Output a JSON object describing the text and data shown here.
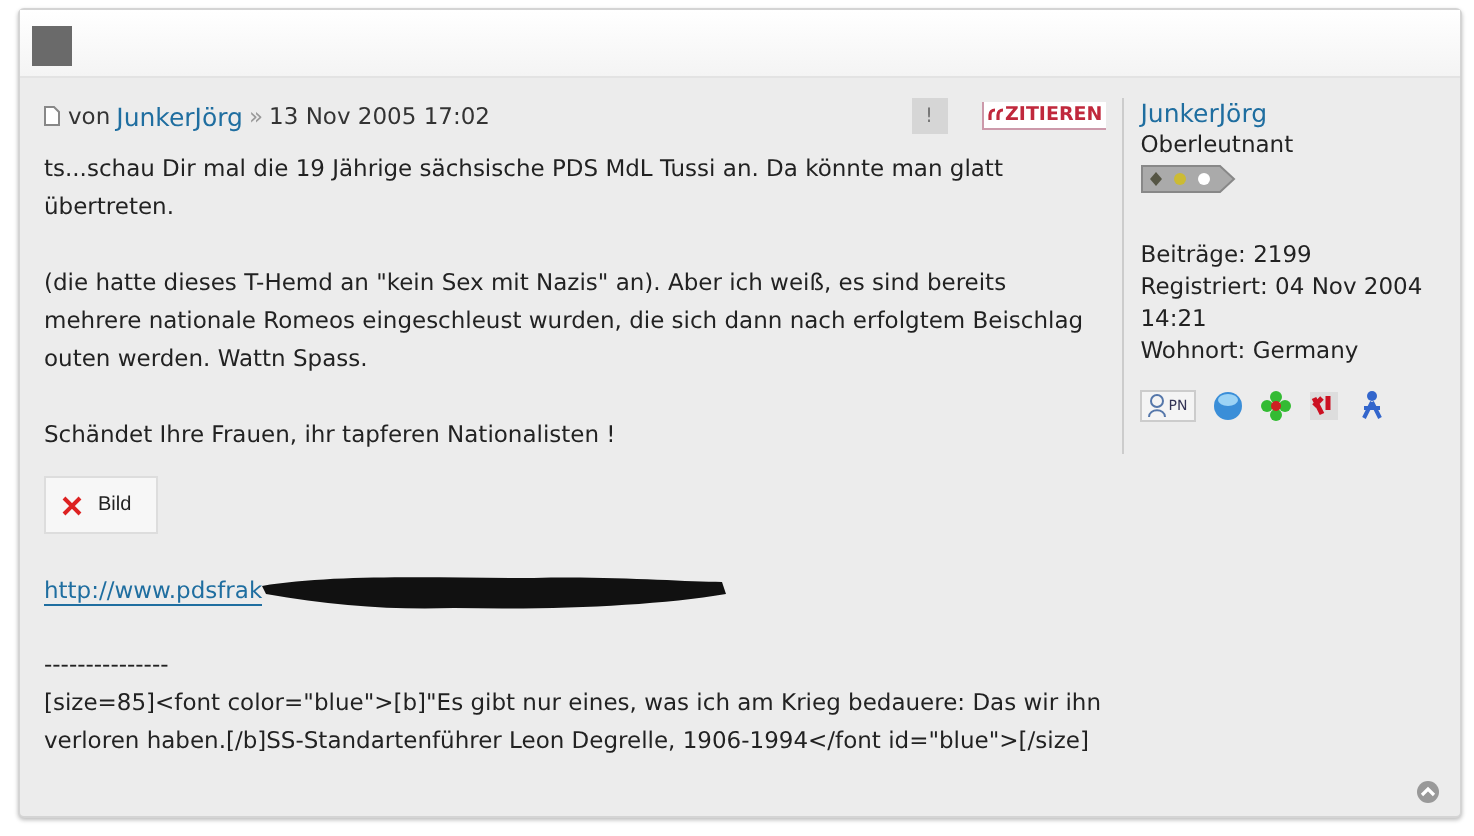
{
  "post": {
    "prefix": "von",
    "author": "JunkerJörg",
    "separator": "»",
    "date": "13 Nov 2005 17:02",
    "report_button": "!",
    "quote_button": "ZITIEREN",
    "paragraphs": [
      "ts...schau Dir mal die 19 Jährige sächsische PDS MdL Tussi an. Da könnte man glatt übertreten.",
      "(die hatte dieses T-Hemd an \"kein Sex mit Nazis\" an). Aber ich weiß, es sind bereits mehrere nationale Romeos eingeschleust wurden, die sich dann nach erfolgtem Beischlag outen werden. Wattn Spass.",
      "Schändet Ihre Frauen, ihr tapferen Nationalisten !"
    ],
    "image_placeholder": "Bild",
    "link": "http://www.pdsfrak",
    "signature_rule": "---------------",
    "signature": "[size=85]<font color=\"blue\">[b]\"Es gibt nur eines, was ich am Krieg bedauere: Das wir ihn verloren haben.[/b]SS-Standartenführer Leon Degrelle, 1906-1994</font id=\"blue\">[/size]"
  },
  "profile": {
    "name": "JunkerJörg",
    "rank": "Oberleutnant",
    "stats": [
      "Beiträge: 2199",
      "Registriert: 04 Nov 2004 14:21",
      "Wohnort: Germany"
    ],
    "pm_label": "PN"
  }
}
